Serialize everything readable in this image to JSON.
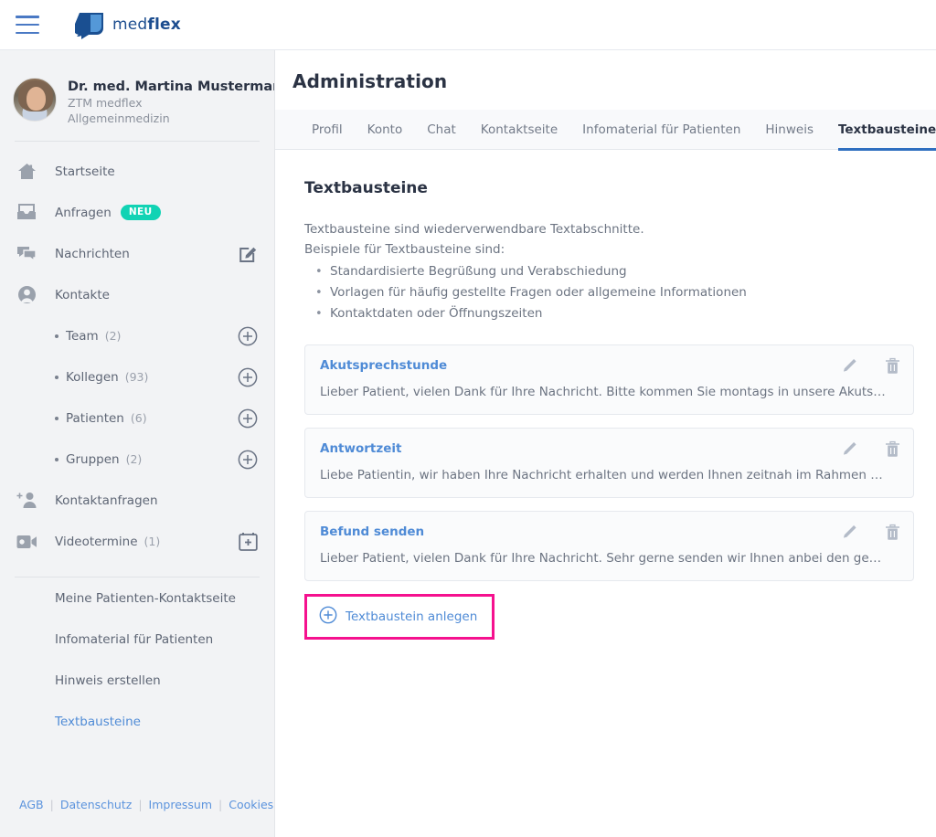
{
  "topbar": {
    "menu_icon": "hamburger-menu-icon",
    "brand_prefix": "med",
    "brand_suffix": "flex",
    "logo_icon": "medflex-speech-bubble-logo"
  },
  "sidebar": {
    "profile": {
      "avatar_icon": "user-avatar-photo",
      "name": "Dr. med. Martina Mustermann",
      "organization": "ZTM medflex",
      "specialty": "Allgemeinmedizin"
    },
    "nav": [
      {
        "label": "Startseite",
        "icon": "home-icon",
        "count": "",
        "badge": "",
        "action_icon": ""
      },
      {
        "label": "Anfragen",
        "icon": "inbox-icon",
        "count": "",
        "badge": "NEU",
        "action_icon": ""
      },
      {
        "label": "Nachrichten",
        "icon": "chat-bubbles-icon",
        "count": "",
        "badge": "",
        "action_icon": "compose-message-icon"
      },
      {
        "label": "Kontakte",
        "icon": "person-circle-icon",
        "count": "",
        "badge": "",
        "action_icon": ""
      }
    ],
    "sub_items": [
      {
        "label": "Team",
        "count": "(2)",
        "action_icon": "plus-circle-icon"
      },
      {
        "label": "Kollegen",
        "count": "(93)",
        "action_icon": "plus-circle-icon"
      },
      {
        "label": "Patienten",
        "count": "(6)",
        "action_icon": "plus-circle-icon"
      },
      {
        "label": "Gruppen",
        "count": "(2)",
        "action_icon": "plus-circle-icon"
      }
    ],
    "nav2": [
      {
        "label": "Kontaktanfragen",
        "icon": "person-add-icon",
        "count": "",
        "action_icon": ""
      },
      {
        "label": "Videotermine",
        "icon": "video-camera-icon",
        "count": "(1)",
        "action_icon": "calendar-add-icon"
      }
    ],
    "plain_items": [
      {
        "label": "Meine Patienten-Kontaktseite",
        "active": false
      },
      {
        "label": "Infomaterial für Patienten",
        "active": false
      },
      {
        "label": "Hinweis erstellen",
        "active": false
      },
      {
        "label": "Textbausteine",
        "active": true
      }
    ],
    "footer_links": [
      "AGB",
      "Datenschutz",
      "Impressum",
      "Cookies"
    ],
    "footer_separator": "|"
  },
  "main": {
    "page_title": "Administration",
    "tabs": [
      {
        "label": "Profil",
        "active": false
      },
      {
        "label": "Konto",
        "active": false
      },
      {
        "label": "Chat",
        "active": false
      },
      {
        "label": "Kontaktseite",
        "active": false
      },
      {
        "label": "Infomaterial für Patienten",
        "active": false
      },
      {
        "label": "Hinweis",
        "active": false
      },
      {
        "label": "Textbausteine",
        "active": true
      }
    ],
    "section_title": "Textbausteine",
    "intro_line1": "Textbausteine sind wiederverwendbare Textabschnitte.",
    "intro_line2": "Beispiele für Textbausteine sind:",
    "bullets": [
      "Standardisierte Begrüßung und Verabschiedung",
      "Vorlagen für häufig gestellte Fragen oder allgemeine Informationen",
      "Kontaktdaten oder Öffnungszeiten"
    ],
    "cards": [
      {
        "title": "Akutsprechstunde",
        "body": "Lieber Patient, vielen Dank für Ihre Nachricht. Bitte kommen Sie montags in unsere Akutsprechstu…",
        "edit_icon": "pencil-edit-icon",
        "delete_icon": "trash-delete-icon"
      },
      {
        "title": "Antwortzeit",
        "body": "Liebe Patientin, wir haben Ihre Nachricht erhalten und werden Ihnen zeitnah im Rahmen unserer S…",
        "edit_icon": "pencil-edit-icon",
        "delete_icon": "trash-delete-icon"
      },
      {
        "title": "Befund senden",
        "body": "Lieber Patient, vielen Dank für Ihre Nachricht. Sehr gerne senden wir Ihnen anbei den gewünschte…",
        "edit_icon": "pencil-edit-icon",
        "delete_icon": "trash-delete-icon"
      }
    ],
    "add_button": {
      "label": "Textbaustein anlegen",
      "icon": "plus-circle-icon"
    }
  },
  "colors": {
    "brand_blue": "#1c4d8f",
    "link_blue": "#4f8bd6",
    "accent_tab_underline": "#2f6fc0",
    "badge_teal": "#11d3b4",
    "highlight_pink": "#f5118e",
    "sidebar_bg": "#f2f3f5",
    "card_bg": "#fafbfc",
    "text_dark": "#2b3344",
    "text_muted": "#6c7482"
  }
}
